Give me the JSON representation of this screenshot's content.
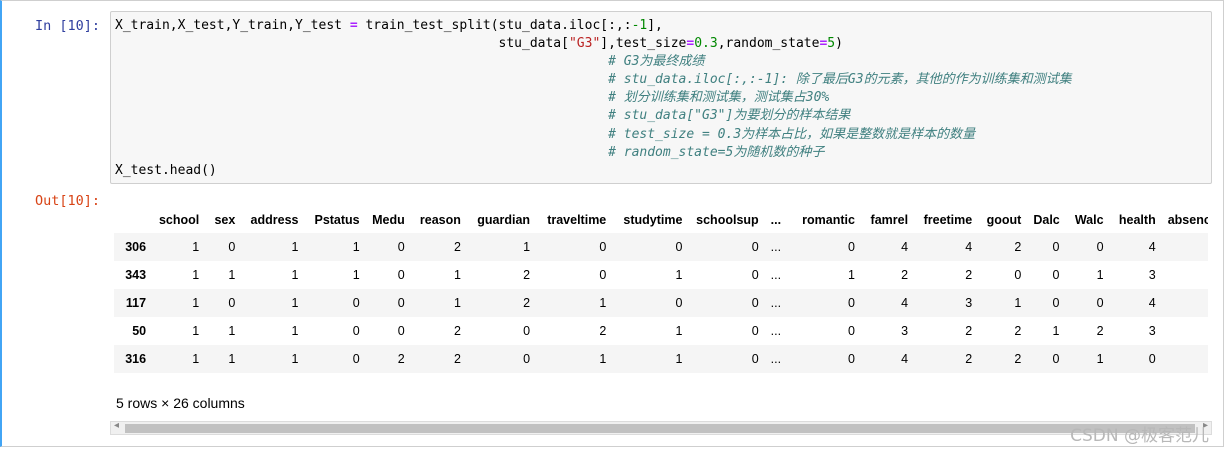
{
  "input_prompt": "In  [10]:",
  "output_prompt": "Out[10]:",
  "code": {
    "line1_a": "X_train,X_test,Y_train,Y_test ",
    "line1_op": "=",
    "line1_b": " train_test_split(stu_data.iloc[:,:",
    "line1_num": "-1",
    "line1_c": "],",
    "line2_indent": "                                                 ",
    "line2_a": "stu_data[",
    "line2_str": "\"G3\"",
    "line2_b": "],test_size",
    "line2_op1": "=",
    "line2_num1": "0.3",
    "line2_c": ",random_state",
    "line2_op2": "=",
    "line2_num2": "5",
    "line2_d": ")",
    "comment_indent": "                                                               ",
    "comments": [
      "# G3为最终成绩",
      "# stu_data.iloc[:,:-1]: 除了最后G3的元素，其他的作为训练集和测试集",
      "# 划分训练集和测试集，测试集占30%",
      "# stu_data[\"G3\"]为要划分的样本结果",
      "# test_size = 0.3为样本占比，如果是整数就是样本的数量",
      "# random_state=5为随机数的种子"
    ],
    "last_line": "X_test.head()"
  },
  "dataframe": {
    "columns": [
      "school",
      "sex",
      "address",
      "Pstatus",
      "Medu",
      "reason",
      "guardian",
      "traveltime",
      "studytime",
      "schoolsup",
      "...",
      "romantic",
      "famrel",
      "freetime",
      "goout",
      "Dalc",
      "Walc",
      "health",
      "absences"
    ],
    "rows": [
      {
        "index": "306",
        "values": [
          "1",
          "0",
          "1",
          "1",
          "0",
          "2",
          "1",
          "0",
          "0",
          "0",
          "...",
          "0",
          "4",
          "4",
          "2",
          "0",
          "0",
          "4",
          ""
        ]
      },
      {
        "index": "343",
        "values": [
          "1",
          "1",
          "1",
          "1",
          "0",
          "1",
          "2",
          "0",
          "1",
          "0",
          "...",
          "1",
          "2",
          "2",
          "0",
          "0",
          "1",
          "3",
          ""
        ]
      },
      {
        "index": "117",
        "values": [
          "1",
          "0",
          "1",
          "0",
          "0",
          "1",
          "2",
          "1",
          "0",
          "0",
          "...",
          "0",
          "4",
          "3",
          "1",
          "0",
          "0",
          "4",
          ""
        ]
      },
      {
        "index": "50",
        "values": [
          "1",
          "1",
          "1",
          "0",
          "0",
          "2",
          "0",
          "2",
          "1",
          "0",
          "...",
          "0",
          "3",
          "2",
          "2",
          "1",
          "2",
          "3",
          ""
        ]
      },
      {
        "index": "316",
        "values": [
          "1",
          "1",
          "1",
          "0",
          "2",
          "2",
          "0",
          "1",
          "1",
          "0",
          "...",
          "0",
          "4",
          "2",
          "2",
          "0",
          "1",
          "0",
          ""
        ]
      }
    ],
    "shape_text": "5 rows × 26 columns"
  },
  "scrollbar": {
    "left_arrow": "◂",
    "right_arrow": "▸"
  },
  "watermark": "CSDN @极客范儿"
}
